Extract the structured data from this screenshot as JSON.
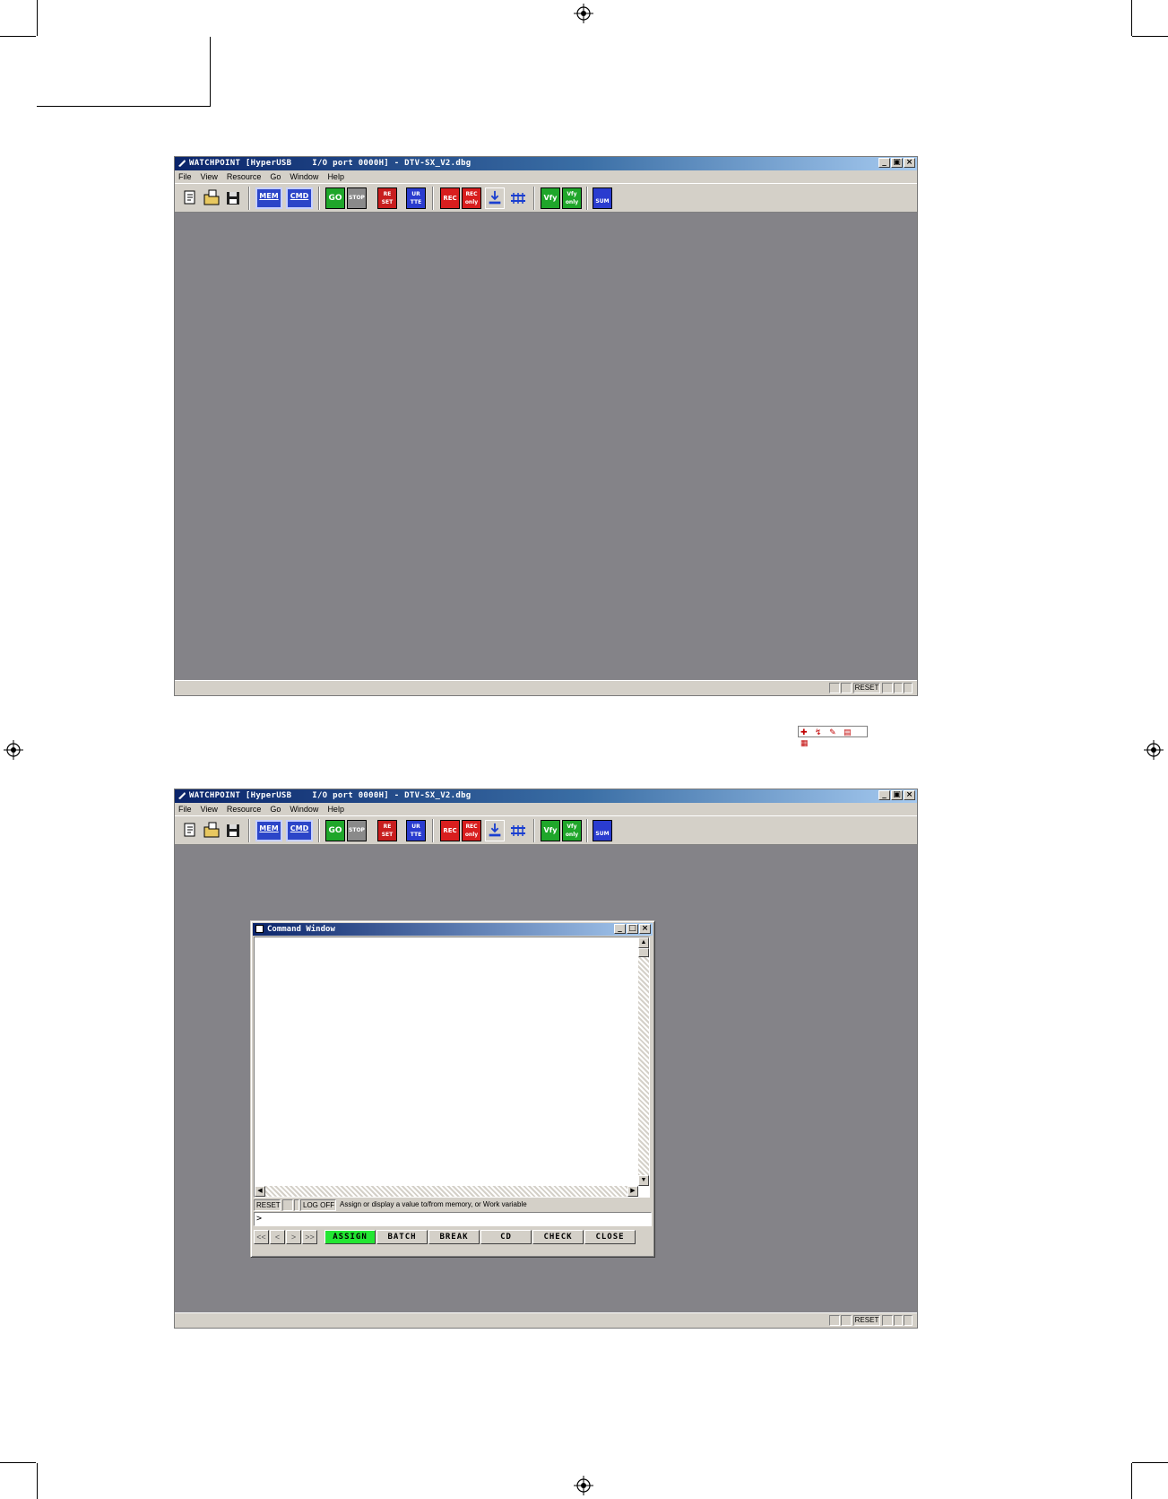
{
  "window_title": "WATCHPOINT [HyperUSB    I/O port 0000H] - DTV-SX_V2.dbg",
  "window_buttons": {
    "minimize": "_",
    "restore": "▣",
    "close": "×"
  },
  "menu": [
    "File",
    "View",
    "Resource",
    "Go",
    "Window",
    "Help"
  ],
  "toolbar": {
    "mem": "MEM",
    "cmd": "CMD",
    "go": "GO",
    "stop": "STOP",
    "reset_a": "RE",
    "reset_b": "SET",
    "ur_a": "UR",
    "ur_b": "TTE",
    "rec": "REC",
    "rec_only_a": "REC",
    "rec_only_b": "only",
    "vfy": "Vfy",
    "vfy_only_a": "Vfy",
    "vfy_only_b": "only",
    "sum": "SUM"
  },
  "statusbar": {
    "reset": "RESET"
  },
  "colors": {
    "desktop": "#848388",
    "chrome": "#d4d0c8",
    "titlebar": "#0a246a",
    "assign_active": "#22e632"
  },
  "command_window": {
    "title": "Command Window",
    "status_reset": "RESET",
    "status_log": "LOG OFF",
    "status_hint": "Assign or display a value to/from memory, or Work variable",
    "prompt": ">",
    "nav": [
      "<<",
      "<",
      ">",
      ">>"
    ],
    "buttons": [
      "ASSIGN",
      "BATCH",
      "BREAK",
      "CD",
      "CHECK",
      "CLOSE"
    ]
  }
}
